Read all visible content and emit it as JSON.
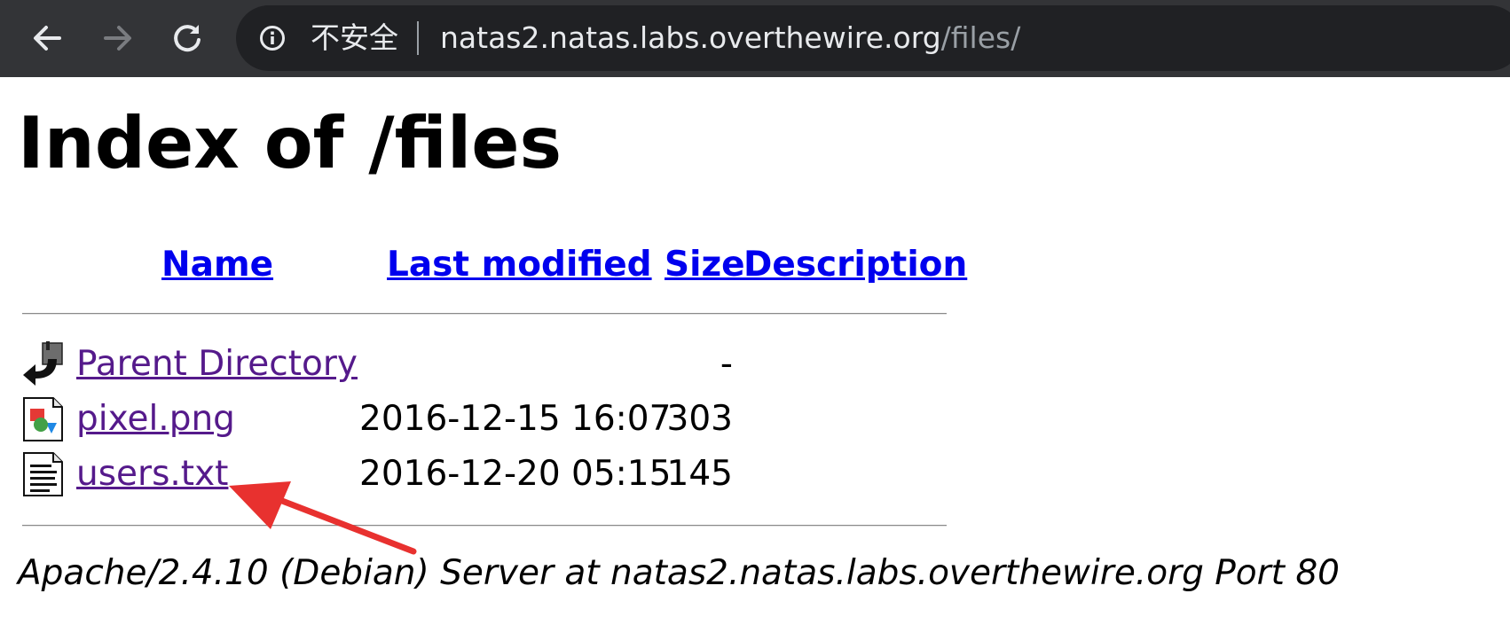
{
  "browser": {
    "security_label": "不安全",
    "url_host": "natas2.natas.labs.overthewire.org",
    "url_path": "/files/",
    "icons": {
      "back": "arrow-left",
      "forward": "arrow-right",
      "reload": "reload",
      "info": "info-circle"
    }
  },
  "page": {
    "title": "Index of /files",
    "columns": {
      "name": "Name",
      "last_modified": "Last modified",
      "size": "Size",
      "description": "Description"
    },
    "rows": [
      {
        "icon": "parent-directory-icon",
        "name": "Parent Directory",
        "modified": "",
        "size": "-"
      },
      {
        "icon": "image-file-icon",
        "name": "pixel.png",
        "modified": "2016-12-15 16:07",
        "size": "303"
      },
      {
        "icon": "text-file-icon",
        "name": "users.txt",
        "modified": "2016-12-20 05:15",
        "size": "145"
      }
    ],
    "footer": "Apache/2.4.10 (Debian) Server at natas2.natas.labs.overthewire.org Port 80"
  },
  "annotation": {
    "arrow_color": "#e8312f"
  },
  "colors": {
    "toolbar_bg": "#333437",
    "omnibox_bg": "#202124",
    "link": "#0000ee",
    "visited_link": "#551a8b"
  }
}
